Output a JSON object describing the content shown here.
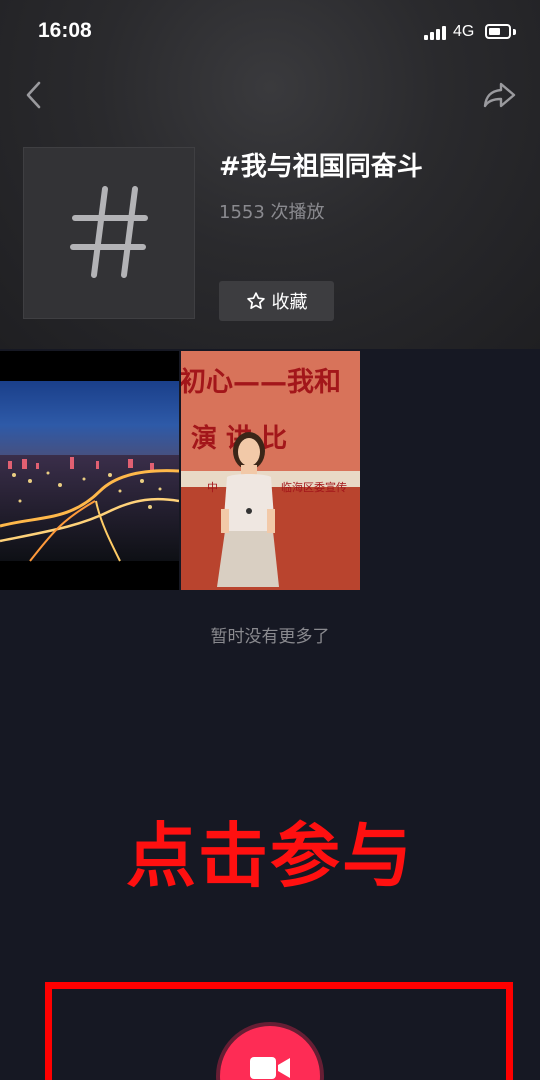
{
  "status_bar": {
    "time": "16:08",
    "network": "4G",
    "battery_level": 0.6
  },
  "nav": {
    "back_icon": "chevron-left-icon",
    "share_icon": "share-arrow-icon"
  },
  "topic": {
    "cover_icon": "hashtag-icon",
    "title": "#我与祖国同奋斗",
    "play_count": "1553 次播放",
    "favorite_label": "收藏",
    "favorite_icon": "star-outline-icon"
  },
  "videos": [
    {
      "kind": "night-city-aerial"
    },
    {
      "kind": "speech-contest",
      "banner_top": "初心——我和",
      "banner_middle": "演 讲 比",
      "banner_sub": "中",
      "banner_sub2": "临海区委宣传"
    }
  ],
  "list_end_text": "暂时没有更多了",
  "cta": {
    "text": "点击参与",
    "color": "#ff1010"
  },
  "record_button": {
    "icon": "video-camera-icon",
    "color": "#fe2c55"
  }
}
